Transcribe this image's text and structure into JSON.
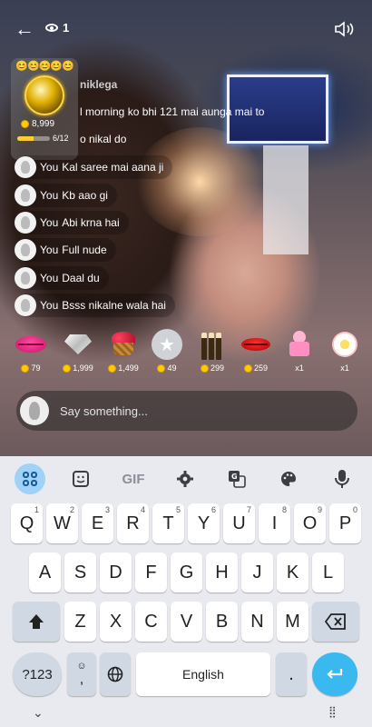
{
  "topbar": {
    "viewer_count": "1"
  },
  "gift_card": {
    "emojis": "😊😊😊😊😊",
    "coins": "8,999",
    "progress_text": "6/12",
    "progress_fraction": 0.5
  },
  "stream_title": "niklega",
  "chat": [
    {
      "user": "",
      "text": "l morning ko bhi 121 mai aunga mai to"
    },
    {
      "user": "",
      "text": "o nikal do"
    },
    {
      "user": "You",
      "text": "Kal saree mai aana ji"
    },
    {
      "user": "You",
      "text": "Kb aao gi"
    },
    {
      "user": "You",
      "text": "Abi krna hai"
    },
    {
      "user": "You",
      "text": "Full nude"
    },
    {
      "user": "You",
      "text": "Daal du"
    },
    {
      "user": "You",
      "text": "Bsss nikalne wala hai"
    }
  ],
  "gifts": [
    {
      "icon": "lips-gift-icon",
      "price": "79"
    },
    {
      "icon": "diamond-gift-icon",
      "price": "1,999"
    },
    {
      "icon": "rose-basket-gift-icon",
      "price": "1,499"
    },
    {
      "icon": "star-gift-icon",
      "price": "49"
    },
    {
      "icon": "champagne-gift-icon",
      "price": "299"
    },
    {
      "icon": "red-lips-gift-icon",
      "price": "259"
    },
    {
      "icon": "cupcake-gift-icon",
      "price": "x1"
    },
    {
      "icon": "flower-gift-icon",
      "price": "x1"
    }
  ],
  "input": {
    "placeholder": "Say something..."
  },
  "keyboard": {
    "toolbar": {
      "gif": "GIF"
    },
    "row1": [
      {
        "k": "Q",
        "n": "1"
      },
      {
        "k": "W",
        "n": "2"
      },
      {
        "k": "E",
        "n": "3"
      },
      {
        "k": "R",
        "n": "4"
      },
      {
        "k": "T",
        "n": "5"
      },
      {
        "k": "Y",
        "n": "6"
      },
      {
        "k": "U",
        "n": "7"
      },
      {
        "k": "I",
        "n": "8"
      },
      {
        "k": "O",
        "n": "9"
      },
      {
        "k": "P",
        "n": "0"
      }
    ],
    "row2": [
      "A",
      "S",
      "D",
      "F",
      "G",
      "H",
      "J",
      "K",
      "L"
    ],
    "row3": [
      "Z",
      "X",
      "C",
      "V",
      "B",
      "N",
      "M"
    ],
    "sym": "?123",
    "comma": ",",
    "space": "English",
    "period": ".",
    "accent": "#39b9ef"
  }
}
